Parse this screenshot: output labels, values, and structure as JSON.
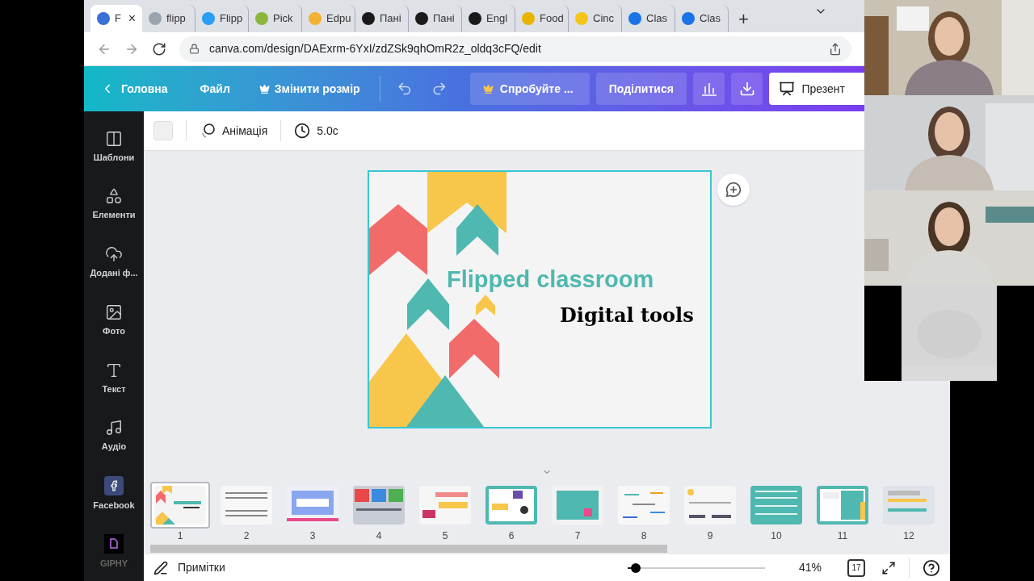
{
  "browser": {
    "tabs": [
      {
        "label": "F",
        "selected": true,
        "color": "#3b6fd8"
      },
      {
        "label": "flipp",
        "selected": false,
        "color": "#9aa4b0"
      },
      {
        "label": "Flipp",
        "selected": false,
        "color": "#2a9df4"
      },
      {
        "label": "Pick",
        "selected": false,
        "color": "#8cb63c"
      },
      {
        "label": "Edpu",
        "selected": false,
        "color": "#f2b233"
      },
      {
        "label": "Пані",
        "selected": false,
        "color": "#1a1a1a"
      },
      {
        "label": "Пані",
        "selected": false,
        "color": "#1a1a1a"
      },
      {
        "label": "Engl",
        "selected": false,
        "color": "#1a1a1a"
      },
      {
        "label": "Food",
        "selected": false,
        "color": "#e8b400"
      },
      {
        "label": "Cinc",
        "selected": false,
        "color": "#f5c518"
      },
      {
        "label": "Clas",
        "selected": false,
        "color": "#1a73e8"
      },
      {
        "label": "Clas",
        "selected": false,
        "color": "#1a73e8"
      }
    ],
    "close": "×",
    "new_tab": "+",
    "url": "canva.com/design/DAExrm-6YxI/zdZSk9qhOmR2z_oldq3cFQ/edit"
  },
  "header": {
    "home": "Головна",
    "file": "Файл",
    "resize": "Змінити розмір",
    "try": "Спробуйте ...",
    "share": "Поділитися",
    "present": "Презент"
  },
  "toolbar": {
    "animation": "Анімація",
    "duration": "5.0с"
  },
  "sidebar": [
    {
      "kind": "templates",
      "label": "Шаблони"
    },
    {
      "kind": "elements",
      "label": "Елементи"
    },
    {
      "kind": "uploads",
      "label": "Додані ф..."
    },
    {
      "kind": "photos",
      "label": "Фото"
    },
    {
      "kind": "text",
      "label": "Текст"
    },
    {
      "kind": "audio",
      "label": "Аудіо"
    },
    {
      "kind": "facebook",
      "label": "Facebook"
    },
    {
      "kind": "giphy",
      "label": "GIPHY"
    }
  ],
  "slide": {
    "title": "Flipped classroom",
    "subtitle": "Digital tools"
  },
  "thumbnails": [
    {
      "number": "1",
      "selected": true
    },
    {
      "number": "2",
      "selected": false
    },
    {
      "number": "3",
      "selected": false
    },
    {
      "number": "4",
      "selected": false
    },
    {
      "number": "5",
      "selected": false
    },
    {
      "number": "6",
      "selected": false
    },
    {
      "number": "7",
      "selected": false
    },
    {
      "number": "8",
      "selected": false
    },
    {
      "number": "9",
      "selected": false
    },
    {
      "number": "10",
      "selected": false
    },
    {
      "number": "11",
      "selected": false
    },
    {
      "number": "12",
      "selected": false
    }
  ],
  "footer": {
    "notes": "Примітки",
    "zoom": {
      "level": 0.06
    },
    "zoom_value": "41%",
    "pages": "17"
  }
}
